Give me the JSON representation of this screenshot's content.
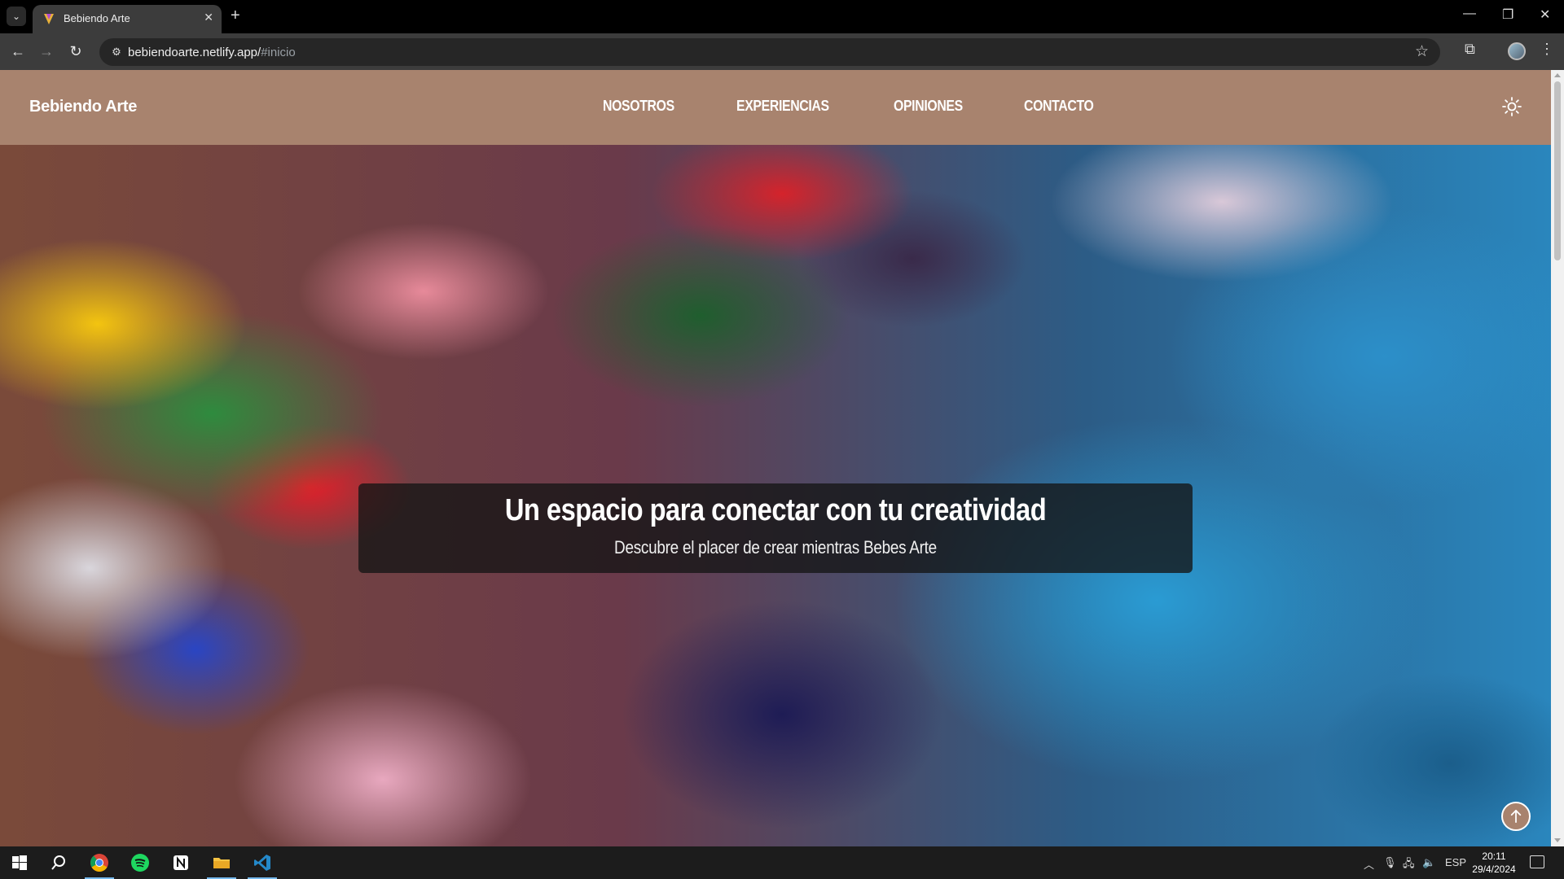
{
  "browser": {
    "tab_title": "Bebiendo Arte",
    "url_host": "bebiendoarte.netlify.app/",
    "url_fragment": "#inicio"
  },
  "site": {
    "brand": "Bebiendo Arte",
    "nav": [
      {
        "label": "NOSOTROS"
      },
      {
        "label": "EXPERIENCIAS"
      },
      {
        "label": "OPINIONES"
      },
      {
        "label": "CONTACTO"
      }
    ],
    "hero": {
      "title": "Un espacio para conectar con tu creatividad",
      "subtitle": "Descubre el placer de crear mientras Bebes Arte"
    },
    "colors": {
      "header_bg": "#a8836e",
      "caption_bg": "rgba(20,20,20,0.78)"
    }
  },
  "taskbar": {
    "language": "ESP",
    "time": "20:11",
    "date": "29/4/2024"
  }
}
